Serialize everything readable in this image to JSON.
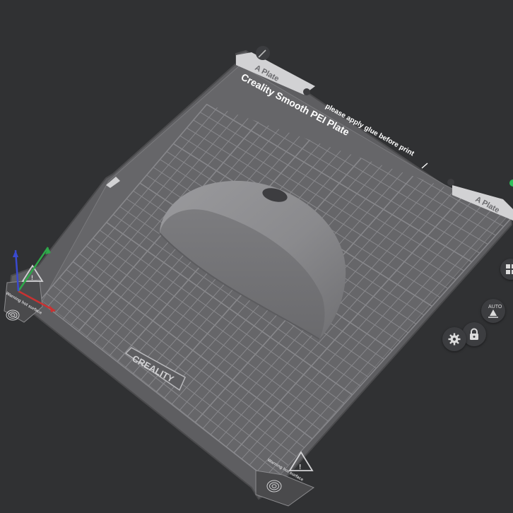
{
  "plate": {
    "name": "Creality Smooth PEI Plate",
    "tab_label_top": "A Plate",
    "tab_label_right": "A Plate",
    "notice": "please apply glue before print",
    "brand": "CREALITY",
    "warning_left": "Warning hot surface",
    "warning_right": "Warning hot surface"
  },
  "toolbar": {
    "auto_label": "AUTO"
  },
  "colors": {
    "background": "#303133",
    "plate": "#6b6b6e",
    "grid": "#8e8e92",
    "model": "#8a8a8d",
    "axis_x": "#c83232",
    "axis_y": "#2fa84a",
    "axis_z": "#3a4ad0"
  }
}
